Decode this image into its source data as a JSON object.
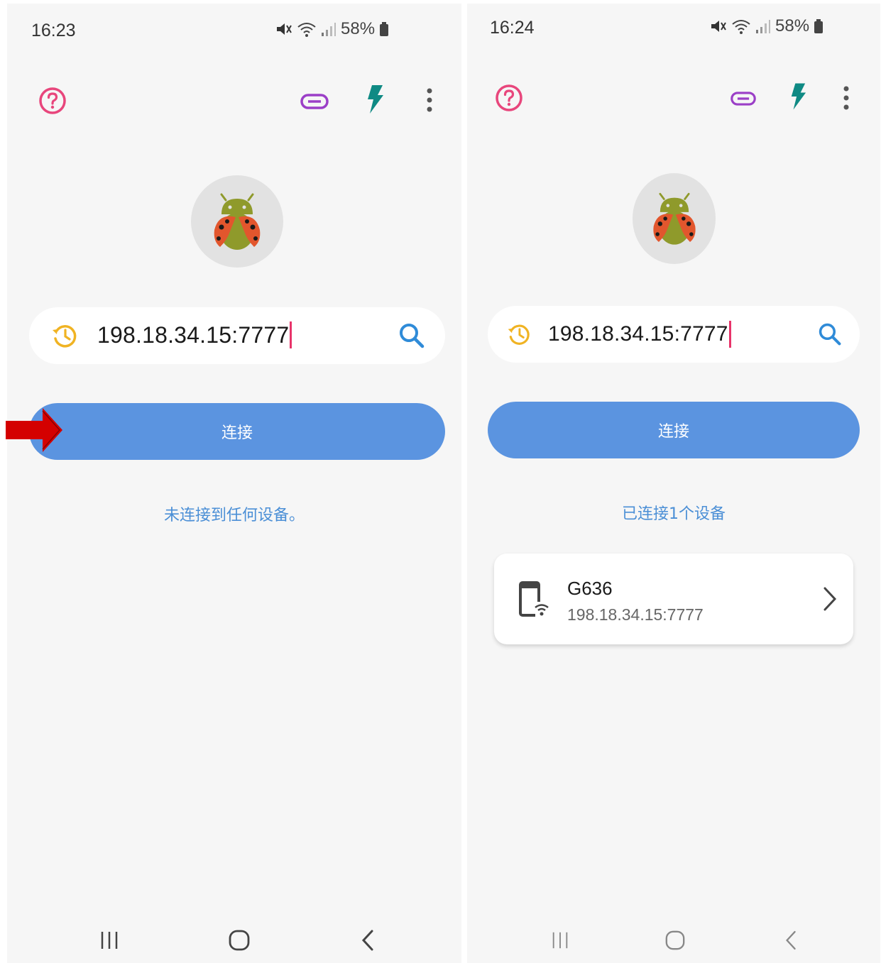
{
  "left": {
    "status": {
      "time": "16:23",
      "battery": "58%"
    },
    "search": {
      "value": "198.18.34.15:7777"
    },
    "connect_label": "连接",
    "status_message": "未连接到任何设备。"
  },
  "right": {
    "status": {
      "time": "16:24",
      "battery": "58%"
    },
    "search": {
      "value": "198.18.34.15:7777"
    },
    "connect_label": "连接",
    "status_message": "已连接1个设备",
    "device": {
      "name": "G636",
      "address": "198.18.34.15:7777"
    }
  },
  "icons": {
    "help": "help-circle-icon",
    "link": "link-icon",
    "flash": "lightning-bolt-icon",
    "more": "more-vertical-icon",
    "history": "history-icon",
    "search": "search-icon",
    "device": "phone-wifi-icon",
    "chevron": "chevron-right-icon",
    "nav_recents": "recents-icon",
    "nav_home": "home-icon",
    "nav_back": "back-icon",
    "annotation": "red-arrow-icon"
  },
  "colors": {
    "help": "#e8467c",
    "link": "#9b3fc7",
    "flash": "#0f8a84",
    "history": "#f0b323",
    "search": "#2f8bd8",
    "button": "#5b94e0",
    "status_text": "#4b8fd6",
    "annotation_arrow": "#d40000"
  }
}
